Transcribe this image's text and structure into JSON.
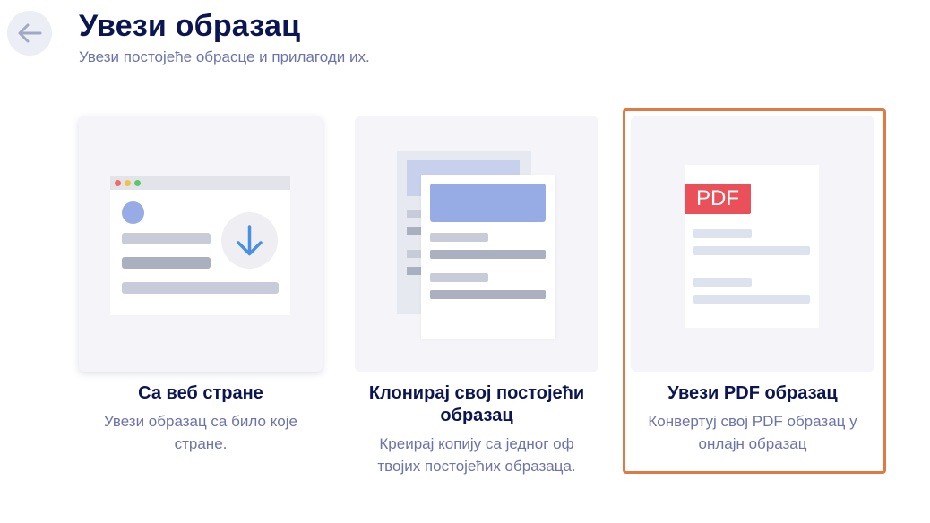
{
  "header": {
    "title": "Увези образац",
    "subtitle": "Увези постојеће обрасце и прилагоди их."
  },
  "cards": [
    {
      "title": "Са веб стране",
      "description": "Увези образац са било које стране."
    },
    {
      "title": "Клонирај свој постојећи образац",
      "description": "Креирај копију са једног оф твојих постојећих образаца."
    },
    {
      "title": "Увези PDF образац",
      "description": "Конвертуј свој PDF образац у онлајн образац",
      "badge": "PDF"
    }
  ],
  "colors": {
    "selected_border": "#e07a45",
    "pdf_badge": "#e9505a",
    "accent_blue": "#4a90e2"
  }
}
